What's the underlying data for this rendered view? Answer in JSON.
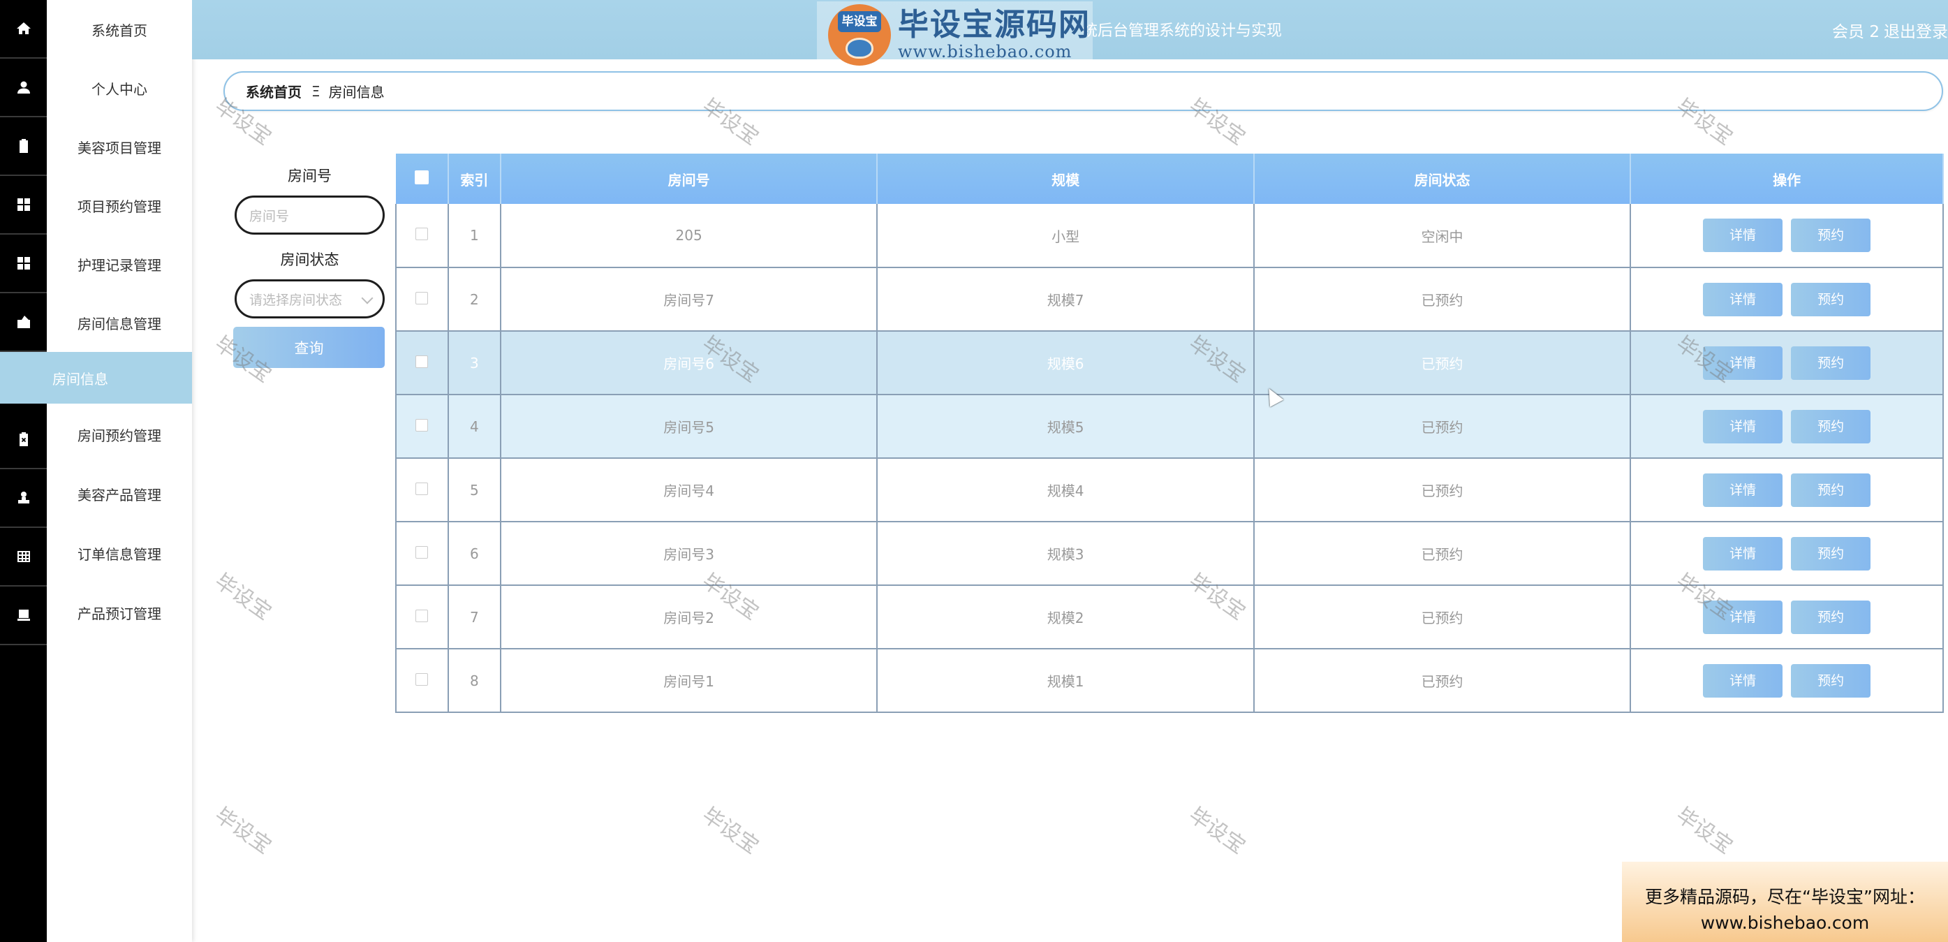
{
  "header": {
    "title": "统后台管理系统的设计与实现",
    "member": "会员 2",
    "logout": "退出登录"
  },
  "logo": {
    "badge": "毕设宝",
    "name": "毕设宝源码网",
    "url": "www.bishebao.com"
  },
  "sidebar": {
    "items": [
      {
        "label": "系统首页",
        "icon": "home-icon"
      },
      {
        "label": "个人中心",
        "icon": "user-icon"
      },
      {
        "label": "美容项目管理",
        "icon": "clipboard-icon"
      },
      {
        "label": "项目预约管理",
        "icon": "grid-icon"
      },
      {
        "label": "护理记录管理",
        "icon": "grid-icon"
      },
      {
        "label": "房间信息管理",
        "icon": "wallet-icon"
      },
      {
        "label": "房间预约管理",
        "icon": "clipboard-x-icon"
      },
      {
        "label": "美容产品管理",
        "icon": "stamp-icon"
      },
      {
        "label": "订单信息管理",
        "icon": "table-icon"
      },
      {
        "label": "产品预订管理",
        "icon": "printer-icon"
      }
    ],
    "active_sub": "房间信息"
  },
  "breadcrumb": {
    "home": "系统首页",
    "sep": "Ξ",
    "current": "房间信息"
  },
  "search": {
    "room_label": "房间号",
    "room_placeholder": "房间号",
    "status_label": "房间状态",
    "status_placeholder": "请选择房间状态",
    "query_button": "查询"
  },
  "table": {
    "headers": [
      "索引",
      "房间号",
      "规模",
      "房间状态",
      "操作"
    ],
    "detail_label": "详情",
    "reserve_label": "预约",
    "rows": [
      {
        "index": "1",
        "room": "205",
        "scale": "小型",
        "status": "空闲中"
      },
      {
        "index": "2",
        "room": "房间号7",
        "scale": "规模7",
        "status": "已预约"
      },
      {
        "index": "3",
        "room": "房间号6",
        "scale": "规模6",
        "status": "已预约"
      },
      {
        "index": "4",
        "room": "房间号5",
        "scale": "规模5",
        "status": "已预约"
      },
      {
        "index": "5",
        "room": "房间号4",
        "scale": "规模4",
        "status": "已预约"
      },
      {
        "index": "6",
        "room": "房间号3",
        "scale": "规模3",
        "status": "已预约"
      },
      {
        "index": "7",
        "room": "房间号2",
        "scale": "规模2",
        "status": "已预约"
      },
      {
        "index": "8",
        "room": "房间号1",
        "scale": "规模1",
        "status": "已预约"
      }
    ]
  },
  "watermark": "毕设宝",
  "promo": {
    "line1": "更多精品源码，尽在“毕设宝”网址：",
    "line2": "www.bishebao.com"
  }
}
